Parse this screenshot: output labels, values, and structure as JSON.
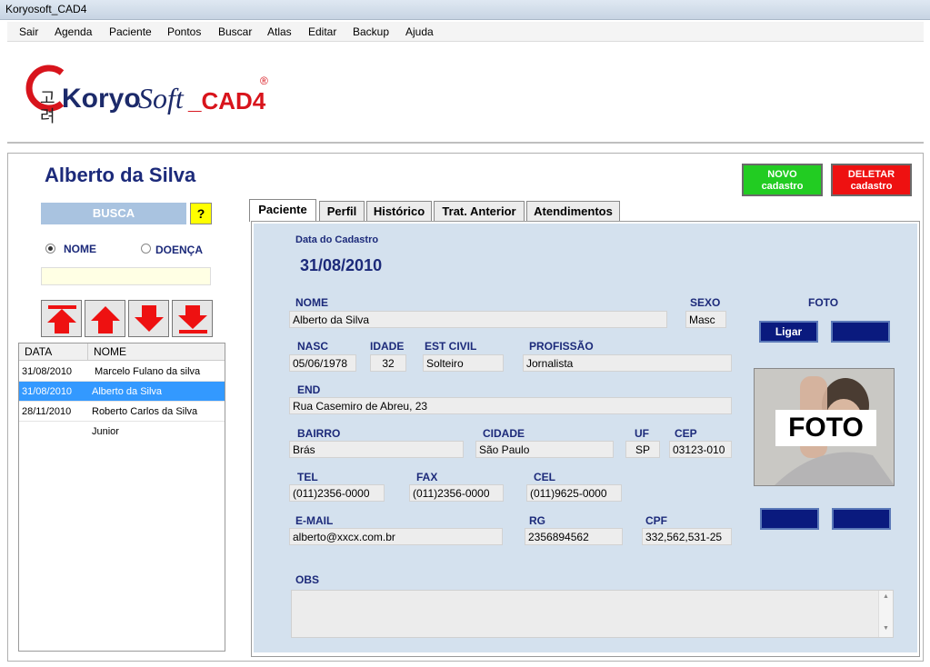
{
  "window": {
    "title": "Koryosoft_CAD4"
  },
  "menu": [
    "Sair",
    "Agenda",
    "Paciente",
    "Pontos",
    "Buscar",
    "Atlas",
    "Editar",
    "Backup",
    "Ajuda"
  ],
  "logo": {
    "hangul_top": "고",
    "hangul_bottom": "려",
    "brand": "Koryo",
    "soft": "Soft",
    "cad": "_CAD4",
    "reg": "®"
  },
  "patient": {
    "name": "Alberto da Silva"
  },
  "actions": {
    "novo_line1": "NOVO",
    "novo_line2": "cadastro",
    "deletar_line1": "DELETAR",
    "deletar_line2": "cadastro",
    "novo_color": "#22cc22",
    "deletar_color": "#ee1111"
  },
  "search": {
    "busca_label": "BUSCA",
    "help_label": "?",
    "radio_nome": "NOME",
    "radio_doenca": "DOENÇA",
    "selected": "NOME",
    "value": ""
  },
  "list": {
    "headers": [
      "DATA",
      "NOME"
    ],
    "rows": [
      {
        "date": "31/08/2010",
        "name": "Marcelo Fulano da silva"
      },
      {
        "date": "31/08/2010",
        "name": "Alberto da Silva",
        "selected": true
      },
      {
        "date": "28/11/2010",
        "name": "Roberto Carlos da Silva Junior"
      }
    ]
  },
  "tabs": [
    "Paciente",
    "Perfil",
    "Histórico",
    "Trat. Anterior",
    "Atendimentos"
  ],
  "form": {
    "cadastro_label": "Data do Cadastro",
    "cadastro_value": "31/08/2010",
    "nome_label": "NOME",
    "nome_value": "Alberto da Silva",
    "sexo_label": "SEXO",
    "sexo_value": "Masc",
    "foto_label": "FOTO",
    "nasc_label": "NASC",
    "nasc_value": "05/06/1978",
    "idade_label": "IDADE",
    "idade_value": "32",
    "estcivil_label": "EST CIVIL",
    "estcivil_value": "Solteiro",
    "profissao_label": "PROFISSÃO",
    "profissao_value": "Jornalista",
    "end_label": "END",
    "end_value": "Rua Casemiro de Abreu, 23",
    "bairro_label": "BAIRRO",
    "bairro_value": "Brás",
    "cidade_label": "CIDADE",
    "cidade_value": "São Paulo",
    "uf_label": "UF",
    "uf_value": "SP",
    "cep_label": "CEP",
    "cep_value": "03123-010",
    "tel_label": "TEL",
    "tel_value": "(011)2356-0000",
    "fax_label": "FAX",
    "fax_value": "(011)2356-0000",
    "cel_label": "CEL",
    "cel_value": "(011)9625-0000",
    "email_label": "E-MAIL",
    "email_value": "alberto@xxcx.com.br",
    "rg_label": "RG",
    "rg_value": "2356894562",
    "cpf_label": "CPF",
    "cpf_value": "332,562,531-25",
    "obs_label": "OBS",
    "obs_value": ""
  },
  "photo": {
    "ligar_label": "Ligar",
    "photo_text": "FOTO"
  }
}
